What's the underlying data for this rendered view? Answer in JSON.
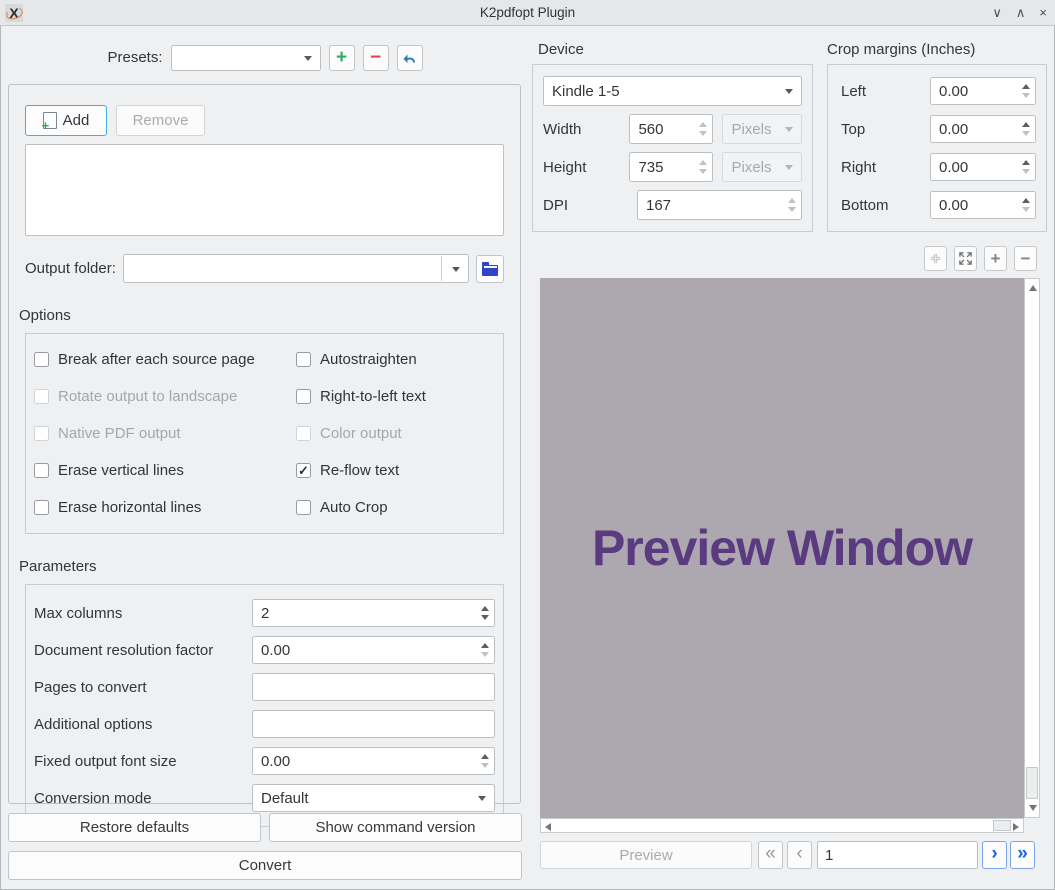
{
  "window": {
    "title": "K2pdfopt Plugin",
    "icon_glyph": "X",
    "controls": {
      "minimize": "∨",
      "maximize": "∧",
      "close": "×"
    }
  },
  "colors": {
    "accent_focus": "#3daee9",
    "preset_add_green": "#27ae60",
    "preset_remove_red": "#da4453",
    "nav_blue": "#1d66e0",
    "preview_background": "#ada7b0",
    "preview_text": "#5a3b80"
  },
  "presets": {
    "label": "Presets:",
    "value": "",
    "add_glyph": "+",
    "remove_glyph": "−"
  },
  "files": {
    "add_label": "Add",
    "remove_label": "Remove",
    "list_items": [],
    "output_folder_label": "Output folder:",
    "output_folder_value": ""
  },
  "options": {
    "title": "Options",
    "check_glyph": "✓",
    "checkboxes": [
      {
        "label": "Break after each source page",
        "checked": false,
        "enabled": true
      },
      {
        "label": "Autostraighten",
        "checked": false,
        "enabled": true
      },
      {
        "label": "Rotate output to landscape",
        "checked": false,
        "enabled": false
      },
      {
        "label": "Right-to-left text",
        "checked": false,
        "enabled": true
      },
      {
        "label": "Native PDF output",
        "checked": false,
        "enabled": false
      },
      {
        "label": "Color output",
        "checked": false,
        "enabled": false
      },
      {
        "label": "Erase vertical lines",
        "checked": false,
        "enabled": true
      },
      {
        "label": "Re-flow text",
        "checked": true,
        "enabled": true
      },
      {
        "label": "Erase horizontal lines",
        "checked": false,
        "enabled": true
      },
      {
        "label": "Auto Crop",
        "checked": false,
        "enabled": true
      }
    ]
  },
  "parameters": {
    "title": "Parameters",
    "rows": [
      {
        "label": "Max columns",
        "value": "2",
        "type": "spin"
      },
      {
        "label": "Document resolution factor",
        "value": "0.00",
        "type": "spin"
      },
      {
        "label": "Pages to convert",
        "value": "",
        "type": "text"
      },
      {
        "label": "Additional options",
        "value": "",
        "type": "text"
      },
      {
        "label": "Fixed output font size",
        "value": "0.00",
        "type": "spin"
      },
      {
        "label": "Conversion mode",
        "value": "Default",
        "type": "combo"
      }
    ]
  },
  "actions": {
    "restore_defaults": "Restore defaults",
    "show_command_version": "Show command version",
    "convert": "Convert"
  },
  "device": {
    "title": "Device",
    "model": "Kindle 1-5",
    "width_label": "Width",
    "width": "560",
    "width_unit": "Pixels",
    "height_label": "Height",
    "height": "735",
    "height_unit": "Pixels",
    "dpi_label": "DPI",
    "dpi": "167"
  },
  "crop": {
    "title": "Crop margins (Inches)",
    "rows": [
      {
        "label": "Left",
        "value": "0.00"
      },
      {
        "label": "Top",
        "value": "0.00"
      },
      {
        "label": "Right",
        "value": "0.00"
      },
      {
        "label": "Bottom",
        "value": "0.00"
      }
    ]
  },
  "preview": {
    "placeholder": "Preview Window",
    "button_label": "Preview",
    "page_value": "1",
    "zoom_in_glyph": "+",
    "zoom_out_glyph": "−",
    "nav": {
      "first": "«",
      "prev": "‹",
      "next": "›",
      "last": "»"
    }
  }
}
